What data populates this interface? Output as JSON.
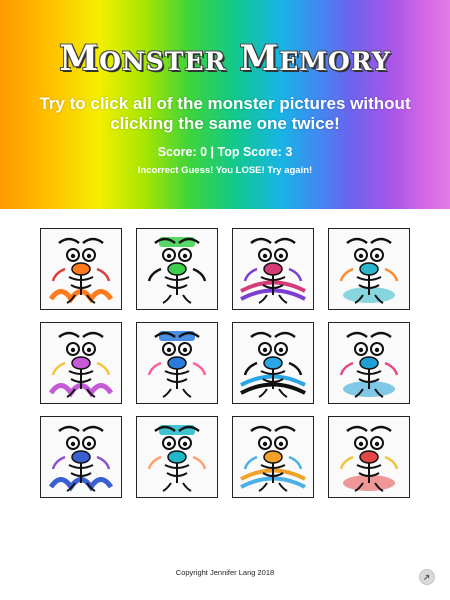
{
  "header": {
    "title": "Monster Memory",
    "subtitle": "Try to click all of the monster pictures without clicking the same one twice!",
    "score_text": "Score: 0 | Top Score: 3",
    "status_text": "Incorrect Guess! You LOSE! Try again!"
  },
  "cards": [
    {
      "accent": "#ff7a1a",
      "accent2": "#e03b3b"
    },
    {
      "accent": "#3ccf4e",
      "accent2": "#111111"
    },
    {
      "accent": "#d63b7a",
      "accent2": "#7a3fd1"
    },
    {
      "accent": "#2bb7c9",
      "accent2": "#ff8a2a"
    },
    {
      "accent": "#c45ad8",
      "accent2": "#f3c43a"
    },
    {
      "accent": "#2a7bdc",
      "accent2": "#ff5fa0"
    },
    {
      "accent": "#2aa6e6",
      "accent2": "#111111"
    },
    {
      "accent": "#1e9fd6",
      "accent2": "#e64a8a"
    },
    {
      "accent": "#3a5fd0",
      "accent2": "#8d4fd0"
    },
    {
      "accent": "#20b7c8",
      "accent2": "#ff9f6b"
    },
    {
      "accent": "#f0a12a",
      "accent2": "#4ab0e6"
    },
    {
      "accent": "#e24646",
      "accent2": "#f4c23a"
    }
  ],
  "footer": {
    "copyright": "Copyright Jennifer Lang 2018",
    "corner_icon": "share-icon"
  }
}
